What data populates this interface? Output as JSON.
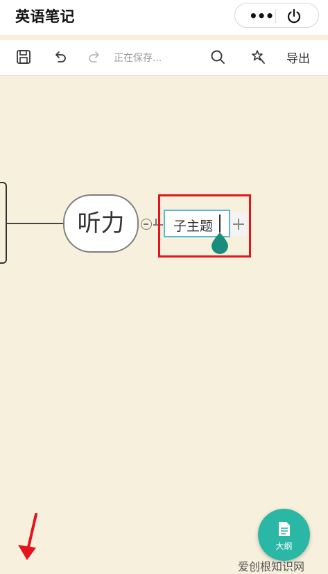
{
  "app": {
    "title": "英语笔记"
  },
  "capsule": {
    "more_label": "•••"
  },
  "toolbar": {
    "save_status": "正在保存...",
    "export_label": "导出"
  },
  "mindmap": {
    "topic": "听力",
    "subtopic": "子主题"
  },
  "outline_button": {
    "label": "大纲"
  },
  "watermark": "爱创根知识网",
  "colors": {
    "canvas_background": "#f7f0dc",
    "highlight_box": "#e3151c",
    "selection_border": "#5ab7d6",
    "handle": "#1a8c7c",
    "fab": "#2bb7a5",
    "annotation_arrow": "#e3151c"
  }
}
